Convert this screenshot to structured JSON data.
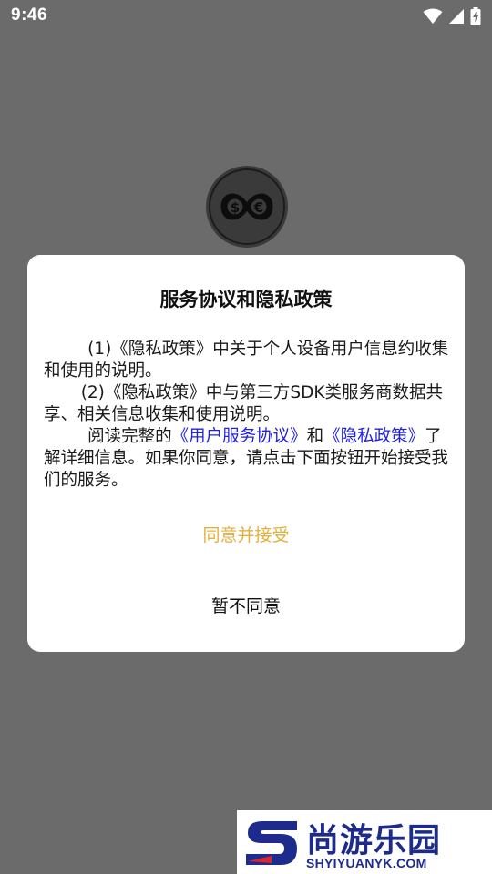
{
  "status_bar": {
    "time": "9:46",
    "icons": [
      "wifi-icon",
      "signal-icon",
      "battery-charging-icon"
    ]
  },
  "app": {
    "logo_icon": "currency-exchange-logo"
  },
  "dialog": {
    "title": "服务协议和隐私政策",
    "para1": "(1)《隐私政策》中关于个人设备用户信息约收集和使用的说明。",
    "para2": "(2)《隐私政策》中与第三方SDK类服务商数据共享、相关信息收集和使用说明。",
    "para3_prefix": "阅读完整的",
    "link_user_agreement": "《用户服务协议》",
    "para3_and": "和",
    "link_privacy_policy": "《隐私政策》",
    "para3_suffix": "了解详细信息。如果你同意，请点击下面按钮开始接受我们的服务。",
    "accept_label": "同意并接受",
    "decline_label": "暂不同意"
  },
  "watermark": {
    "title": "尚游乐园",
    "url": "SHYIYUANYK.COM"
  },
  "colors": {
    "overlay": "#6b6b6b",
    "accept": "#e2b13c",
    "link": "#2222dd",
    "watermark": "#1d2b8c"
  }
}
